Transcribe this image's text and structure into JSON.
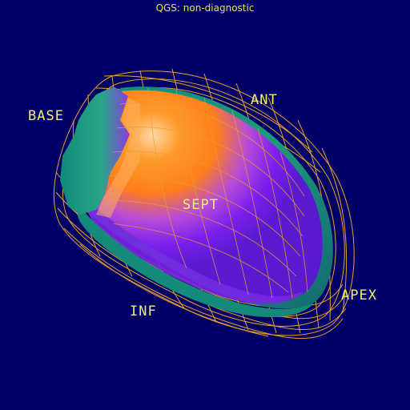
{
  "title": "QGS: non-diagnostic",
  "labels": {
    "base": "BASE",
    "ant": "ANT",
    "sept": "SEPT",
    "inf": "INF",
    "apex": "APEX"
  },
  "colors": {
    "background": "#000066",
    "mesh": "#e8a030",
    "label": "#f0f070",
    "surface_hot": "#ff8c1a",
    "surface_mid": "#8a2be2",
    "surface_cool": "#1a8a7a"
  }
}
